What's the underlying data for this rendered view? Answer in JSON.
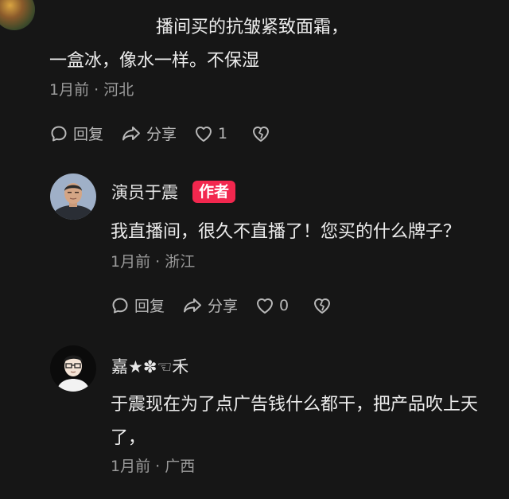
{
  "comment1": {
    "line1": "播间买的抗皱紧致面霜，",
    "line2": "一盒冰，像水一样。不保湿",
    "time": "1月前",
    "sep": "·",
    "location": "河北",
    "reply_label": "回复",
    "share_label": "分享",
    "like_count": "1"
  },
  "comment2": {
    "author": "演员于震",
    "badge": "作者",
    "text": "我直播间，很久不直播了！您买的什么牌子？",
    "time": "1月前",
    "sep": "·",
    "location": "浙江",
    "reply_label": "回复",
    "share_label": "分享",
    "like_count": "0"
  },
  "comment3": {
    "author": "嘉★✽☜禾",
    "line1": "于震现在为了点广告钱什么都干，把产品吹上天",
    "line2": "了，",
    "time": "1月前",
    "sep": "·",
    "location": "广西"
  },
  "colors": {
    "background": "#161616",
    "badge": "#f2274e",
    "meta": "#9b9b9b"
  }
}
